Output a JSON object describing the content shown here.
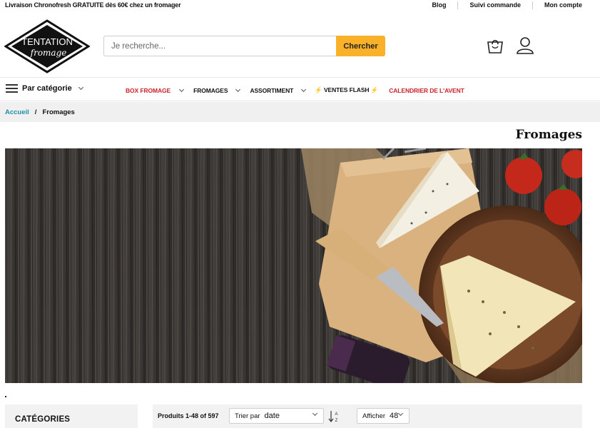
{
  "topbar": {
    "promo": "Livraison Chronofresh GRATUITE dès 60€ chez un fromager",
    "links": [
      "Blog",
      "Suivi commande",
      "Mon compte"
    ]
  },
  "header": {
    "logo": {
      "line1": "TENTATION",
      "line2": "fromage"
    },
    "search_placeholder": "Je recherche...",
    "search_button": "Chercher",
    "cart_icon": "shopping-bag-icon",
    "account_icon": "user-icon"
  },
  "nav": {
    "category_label": "Par catégorie",
    "items": [
      {
        "label": "BOX FROMAGE",
        "color": "#c8232c",
        "dropdown": true
      },
      {
        "label": "FROMAGES",
        "color": "#111111",
        "dropdown": true
      },
      {
        "label": "ASSORTIMENT",
        "color": "#111111",
        "dropdown": true
      },
      {
        "label": "⚡ VENTES FLASH ⚡",
        "color": "#111111",
        "dropdown": false
      },
      {
        "label": "CALENDRIER DE L'AVENT",
        "color": "#c8232c",
        "dropdown": false
      }
    ]
  },
  "breadcrumb": {
    "home": "Accueil",
    "separator": "/",
    "current": "Fromages"
  },
  "page_title": "Fromages",
  "sidebar": {
    "title": "CATÉGORIES"
  },
  "toolbar": {
    "count": "Produits 1-48 of 597",
    "sort_label": "Trier par",
    "sort_value": "date",
    "show_label": "Afficher",
    "show_value": "48"
  },
  "colors": {
    "accent": "#f8b129",
    "link": "#1e8fa8",
    "promo_red": "#c8232c"
  }
}
